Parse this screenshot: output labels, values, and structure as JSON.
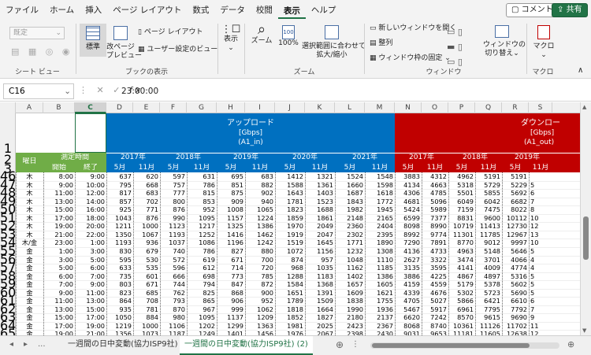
{
  "menu": {
    "items": [
      "ファイル",
      "ホーム",
      "挿入",
      "ページ レイアウト",
      "数式",
      "データ",
      "校閲",
      "表示",
      "ヘルプ"
    ],
    "active": "表示",
    "comment_label": "コメント",
    "share_label": "共有"
  },
  "ribbon": {
    "sheet_view": {
      "dropdown": "既定",
      "label": "シート ビュー"
    },
    "book_view": {
      "normal": "標準",
      "page_break": "改ページ\nプレビュー",
      "page_layout": "ページ レイアウト",
      "custom": "ユーザー設定のビュー",
      "label": "ブックの表示"
    },
    "show": {
      "label_btn": "表示"
    },
    "zoom": {
      "zoom": "ズーム",
      "hundred": "100%",
      "fit": "選択範囲に合わせて\n拡大/縮小",
      "label": "ズーム"
    },
    "window": {
      "new_window": "新しいウィンドウを開く",
      "arrange": "整列",
      "freeze": "ウィンドウ枠の固定",
      "switch": "ウィンドウの\n切り替え",
      "label": "ウィンドウ"
    },
    "macro": {
      "btn": "マクロ",
      "label": "マクロ"
    }
  },
  "formula_bar": {
    "name_box": "C16",
    "fx": "fx",
    "value": "23:00:00"
  },
  "columns": [
    "A",
    "B",
    "C",
    "D",
    "E",
    "F",
    "G",
    "H",
    "I",
    "J",
    "K",
    "L",
    "M",
    "N",
    "O",
    "P",
    "Q",
    "R",
    "S"
  ],
  "header": {
    "upload_title": "アップロード",
    "upload_unit": "[Gbps]",
    "upload_code": "(A1_in)",
    "download_title": "ダウンロー",
    "download_unit": "[Gbps]",
    "download_code": "(A1_out)",
    "day_label": "曜日",
    "time_label": "測定時間",
    "start_label": "開始",
    "end_label": "終了",
    "years_up": [
      "2017年",
      "2018年",
      "2019年",
      "2020年",
      "2021年"
    ],
    "years_down": [
      "2017年",
      "2018年",
      "2019年"
    ],
    "months": [
      "5月",
      "11月"
    ]
  },
  "rows": [
    {
      "n": "46",
      "d": "木",
      "s": "8:00",
      "e": "9:00",
      "v": [
        "637",
        "620",
        "597",
        "631",
        "695",
        "683",
        "1412",
        "1321",
        "1524",
        "1548",
        "3883",
        "4312",
        "4962",
        "5191"
      ]
    },
    {
      "n": "47",
      "d": "木",
      "s": "9:00",
      "e": "10:00",
      "v": [
        "795",
        "668",
        "757",
        "786",
        "851",
        "882",
        "1588",
        "1361",
        "1660",
        "1598",
        "4134",
        "4663",
        "5318",
        "5729"
      ]
    },
    {
      "n": "48",
      "d": "木",
      "s": "11:00",
      "e": "12:00",
      "v": [
        "817",
        "683",
        "777",
        "815",
        "875",
        "902",
        "1643",
        "1403",
        "1687",
        "1618",
        "4306",
        "4785",
        "5501",
        "5855"
      ]
    },
    {
      "n": "49",
      "d": "木",
      "s": "13:00",
      "e": "14:00",
      "v": [
        "857",
        "702",
        "800",
        "853",
        "909",
        "940",
        "1781",
        "1523",
        "1843",
        "1772",
        "4681",
        "5096",
        "6049",
        "6042"
      ]
    },
    {
      "n": "50",
      "d": "木",
      "s": "15:00",
      "e": "16:00",
      "v": [
        "925",
        "771",
        "876",
        "952",
        "1008",
        "1065",
        "1823",
        "1688",
        "1982",
        "1945",
        "5424",
        "5989",
        "7159",
        "7475"
      ]
    },
    {
      "n": "51",
      "d": "木",
      "s": "17:00",
      "e": "18:00",
      "v": [
        "1043",
        "876",
        "990",
        "1095",
        "1157",
        "1224",
        "1859",
        "1861",
        "2148",
        "2165",
        "6599",
        "7377",
        "8831",
        "9600"
      ]
    },
    {
      "n": "52",
      "d": "木",
      "s": "19:00",
      "e": "20:00",
      "v": [
        "1211",
        "1000",
        "1123",
        "1217",
        "1325",
        "1386",
        "1970",
        "2049",
        "2360",
        "2404",
        "8098",
        "8990",
        "10719",
        "11413"
      ]
    },
    {
      "n": "53",
      "d": "木",
      "s": "21:00",
      "e": "22:00",
      "v": [
        "1350",
        "1067",
        "1193",
        "1252",
        "1416",
        "1462",
        "1919",
        "2047",
        "2302",
        "2395",
        "8992",
        "9774",
        "11301",
        "11785"
      ]
    },
    {
      "n": "54",
      "d": "木/金",
      "s": "23:00",
      "e": "1:00",
      "v": [
        "1193",
        "936",
        "1037",
        "1086",
        "1196",
        "1242",
        "1519",
        "1645",
        "1771",
        "1890",
        "7290",
        "7891",
        "8770",
        "9012"
      ]
    },
    {
      "n": "55",
      "d": "金",
      "s": "1:00",
      "e": "3:00",
      "v": [
        "830",
        "679",
        "740",
        "786",
        "827",
        "880",
        "1072",
        "1156",
        "1232",
        "1308",
        "4136",
        "4733",
        "4963",
        "5148"
      ]
    },
    {
      "n": "56",
      "d": "金",
      "s": "3:00",
      "e": "5:00",
      "v": [
        "595",
        "530",
        "572",
        "619",
        "671",
        "700",
        "874",
        "957",
        "1048",
        "1110",
        "2627",
        "3322",
        "3474",
        "3701"
      ]
    },
    {
      "n": "57",
      "d": "金",
      "s": "5:00",
      "e": "6:00",
      "v": [
        "633",
        "535",
        "596",
        "612",
        "714",
        "720",
        "968",
        "1035",
        "1162",
        "1185",
        "3135",
        "3595",
        "4141",
        "4009"
      ]
    },
    {
      "n": "58",
      "d": "金",
      "s": "6:00",
      "e": "7:00",
      "v": [
        "735",
        "601",
        "666",
        "698",
        "773",
        "785",
        "1288",
        "1183",
        "1402",
        "1386",
        "3886",
        "4225",
        "4867",
        "4897"
      ]
    },
    {
      "n": "59",
      "d": "金",
      "s": "7:00",
      "e": "9:00",
      "v": [
        "803",
        "671",
        "744",
        "794",
        "847",
        "872",
        "1584",
        "1368",
        "1657",
        "1605",
        "4159",
        "4559",
        "5179",
        "5378"
      ]
    },
    {
      "n": "60",
      "d": "金",
      "s": "9:00",
      "e": "11:00",
      "v": [
        "823",
        "685",
        "762",
        "825",
        "868",
        "900",
        "1651",
        "1391",
        "1609",
        "1621",
        "4339",
        "4676",
        "5302",
        "5723"
      ]
    },
    {
      "n": "61",
      "d": "金",
      "s": "11:00",
      "e": "13:00",
      "v": [
        "864",
        "708",
        "793",
        "865",
        "906",
        "952",
        "1789",
        "1509",
        "1838",
        "1755",
        "4705",
        "5027",
        "5866",
        "6421"
      ]
    },
    {
      "n": "62",
      "d": "金",
      "s": "13:00",
      "e": "15:00",
      "v": [
        "935",
        "781",
        "870",
        "967",
        "999",
        "1062",
        "1818",
        "1664",
        "1990",
        "1936",
        "5467",
        "5917",
        "6961",
        "7795"
      ]
    },
    {
      "n": "63",
      "d": "金",
      "s": "15:00",
      "e": "17:00",
      "v": [
        "1050",
        "884",
        "980",
        "1095",
        "1137",
        "1209",
        "1852",
        "1827",
        "2180",
        "2137",
        "6620",
        "7242",
        "8570",
        "9615"
      ]
    },
    {
      "n": "64",
      "d": "金",
      "s": "17:00",
      "e": "19:00",
      "v": [
        "1219",
        "1000",
        "1106",
        "1202",
        "1299",
        "1363",
        "1981",
        "2025",
        "2423",
        "2367",
        "8068",
        "8740",
        "10361",
        "11126"
      ]
    },
    {
      "n": "65",
      "d": "金",
      "s": "19:00",
      "e": "21:00",
      "v": [
        "1356",
        "1073",
        "1187",
        "1249",
        "1401",
        "1456",
        "1976",
        "2067",
        "2398",
        "2430",
        "9031",
        "9653",
        "11181",
        "11605"
      ]
    }
  ],
  "right_extra": [
    "5229",
    "5692",
    "6682",
    "8022",
    "10112",
    "12730",
    "12967",
    "9997",
    "5646",
    "4066",
    "4774",
    "5316",
    "5602",
    "5690",
    "6610",
    "7792",
    "9690",
    "11702",
    "12638"
  ],
  "right_extra2": [
    "5",
    "6",
    "7",
    "8",
    "10",
    "12",
    "13",
    "10",
    "5",
    "4",
    "4",
    "5",
    "5",
    "5",
    "6",
    "7",
    "9",
    "11",
    "12"
  ],
  "tabs": {
    "sheet1": "一週間の日中変動(協力ISP9社)",
    "sheet2": "一週間の日中変動(協力ISP9社) (2)",
    "dots": "..."
  }
}
